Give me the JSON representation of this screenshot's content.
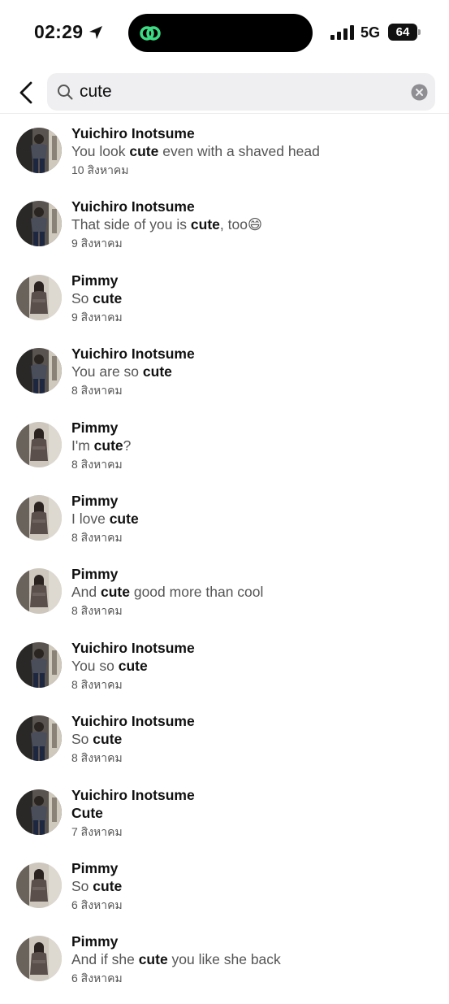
{
  "status_bar": {
    "time": "02:29",
    "network": "5G",
    "battery": "64"
  },
  "search": {
    "query": "cute"
  },
  "results": [
    {
      "name": "Yuichiro Inotsume",
      "avatar": "avatar-yuichiro",
      "before": "You look ",
      "match": "cute",
      "after": " even with a shaved head",
      "date": "10 สิงหาคม"
    },
    {
      "name": "Yuichiro Inotsume",
      "avatar": "avatar-yuichiro",
      "before": "That side of you is ",
      "match": "cute",
      "after": ", too😄",
      "date": "9 สิงหาคม"
    },
    {
      "name": "Pimmy",
      "avatar": "avatar-pimmy",
      "before": "So ",
      "match": "cute",
      "after": "",
      "date": "9 สิงหาคม"
    },
    {
      "name": "Yuichiro Inotsume",
      "avatar": "avatar-yuichiro",
      "before": "You are so ",
      "match": "cute",
      "after": "",
      "date": "8 สิงหาคม"
    },
    {
      "name": "Pimmy",
      "avatar": "avatar-pimmy",
      "before": "I'm ",
      "match": "cute",
      "after": "?",
      "date": "8 สิงหาคม"
    },
    {
      "name": "Pimmy",
      "avatar": "avatar-pimmy",
      "before": "I love ",
      "match": "cute",
      "after": "",
      "date": "8 สิงหาคม"
    },
    {
      "name": "Pimmy",
      "avatar": "avatar-pimmy",
      "before": "And ",
      "match": "cute",
      "after": " good more than cool",
      "date": "8 สิงหาคม"
    },
    {
      "name": "Yuichiro Inotsume",
      "avatar": "avatar-yuichiro",
      "before": "You so ",
      "match": "cute",
      "after": "",
      "date": "8 สิงหาคม"
    },
    {
      "name": "Yuichiro Inotsume",
      "avatar": "avatar-yuichiro",
      "before": "So ",
      "match": "cute",
      "after": "",
      "date": "8 สิงหาคม"
    },
    {
      "name": "Yuichiro Inotsume",
      "avatar": "avatar-yuichiro",
      "before": "",
      "match": "Cute",
      "after": "",
      "date": "7 สิงหาคม"
    },
    {
      "name": "Pimmy",
      "avatar": "avatar-pimmy",
      "before": "So ",
      "match": "cute",
      "after": "",
      "date": "6 สิงหาคม"
    },
    {
      "name": "Pimmy",
      "avatar": "avatar-pimmy",
      "before": "And if she ",
      "match": "cute",
      "after": " you like she back",
      "date": "6 สิงหาคม"
    }
  ]
}
